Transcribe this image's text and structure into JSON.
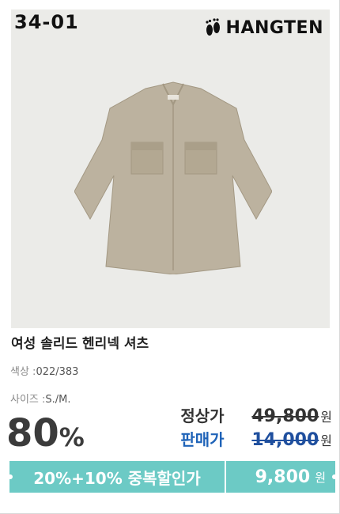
{
  "product": {
    "code": "34-01",
    "brand": "HANGTEN",
    "title": "여성 솔리드 헨리넥 셔츠",
    "color_label": "색상 :",
    "color_value": "022/383",
    "size_label": "사이즈 :",
    "size_value": "S./M."
  },
  "pricing": {
    "discount_number": "80",
    "discount_symbol": "%",
    "regular_label": "정상가",
    "regular_price": "49,800",
    "sale_label": "판매가",
    "sale_price": "14,000",
    "currency": "원"
  },
  "promo": {
    "label": "20%+10% 중복할인가",
    "final_price": "9,800",
    "currency": "원"
  },
  "colors": {
    "banner": "#6ccac5",
    "sale_blue": "#1f63b8",
    "shirt": "#bcb29f"
  }
}
